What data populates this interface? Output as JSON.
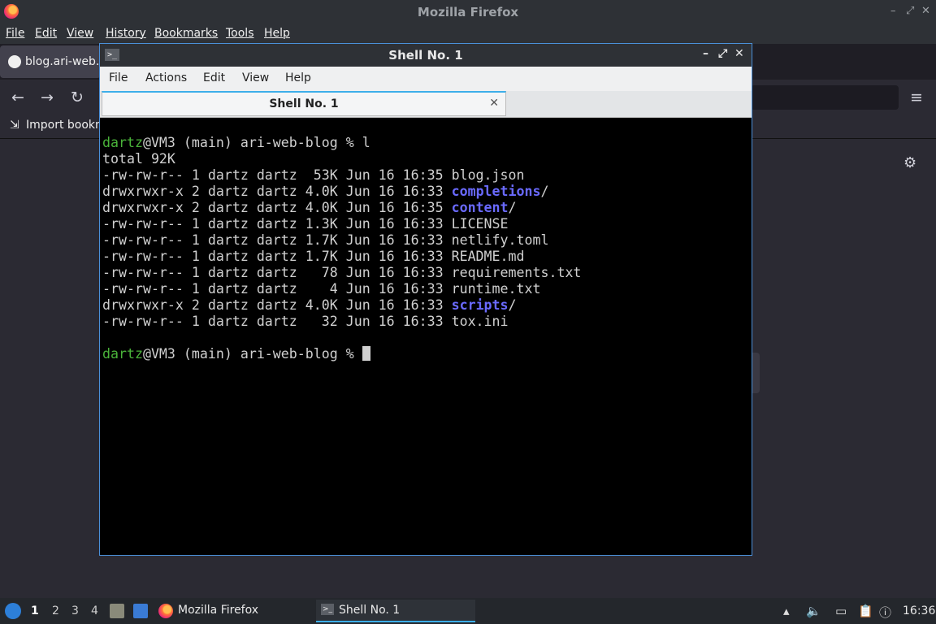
{
  "firefox": {
    "title": "Mozilla Firefox",
    "menu": [
      "File",
      "Edit",
      "View",
      "History",
      "Bookmarks",
      "Tools",
      "Help"
    ],
    "tab_title": "blog.ari-web.x",
    "bookmark_label": "Import bookm"
  },
  "terminal": {
    "title": "Shell No. 1",
    "menu": [
      "File",
      "Actions",
      "Edit",
      "View",
      "Help"
    ],
    "tab_label": "Shell No. 1",
    "lines": {
      "prompt1_user": "dartz",
      "prompt1_rest": "@VM3 (main) ari-web-blog % l",
      "total": "total 92K",
      "f1": "-rw-rw-r-- 1 dartz dartz  53K Jun 16 16:35 blog.json",
      "f2_meta": "drwxrwxr-x 2 dartz dartz 4.0K Jun 16 16:33 ",
      "f2_name": "completions",
      "f3_meta": "drwxrwxr-x 2 dartz dartz 4.0K Jun 16 16:35 ",
      "f3_name": "content",
      "f4": "-rw-rw-r-- 1 dartz dartz 1.3K Jun 16 16:33 LICENSE",
      "f5": "-rw-rw-r-- 1 dartz dartz 1.7K Jun 16 16:33 netlify.toml",
      "f6": "-rw-rw-r-- 1 dartz dartz 1.7K Jun 16 16:33 README.md",
      "f7": "-rw-rw-r-- 1 dartz dartz   78 Jun 16 16:33 requirements.txt",
      "f8": "-rw-rw-r-- 1 dartz dartz    4 Jun 16 16:33 runtime.txt",
      "f9_meta": "drwxrwxr-x 2 dartz dartz 4.0K Jun 16 16:33 ",
      "f9_name": "scripts",
      "f10": "-rw-rw-r-- 1 dartz dartz   32 Jun 16 16:33 tox.ini",
      "prompt2_user": "dartz",
      "prompt2_rest": "@VM3 (main) ari-web-blog % ",
      "slash": "/"
    }
  },
  "taskbar": {
    "workspaces": [
      "1",
      "2",
      "3",
      "4"
    ],
    "active_workspace": "1",
    "tasks": [
      "Mozilla Firefox",
      "Shell No. 1"
    ],
    "clock": "16:36"
  }
}
